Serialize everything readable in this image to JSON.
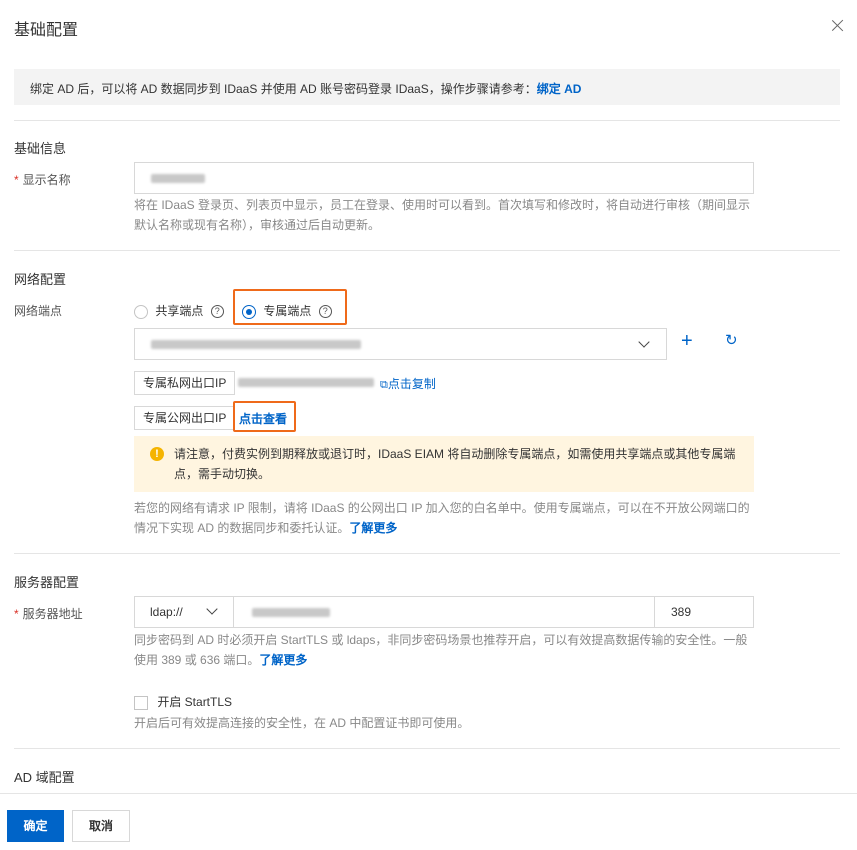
{
  "dialog": {
    "title": "基础配置"
  },
  "notice": {
    "text": "绑定 AD 后，可以将 AD 数据同步到 IDaaS 并使用 AD 账号密码登录 IDaaS，操作步骤请参考：",
    "link": "绑定 AD"
  },
  "basic_info": {
    "section_title": "基础信息",
    "display_name_label": "显示名称",
    "display_name_help": "将在 IDaaS 登录页、列表页中显示，员工在登录、使用时可以看到。首次填写和修改时，将自动进行审核（期间显示默认名称或现有名称），审核通过后自动更新。"
  },
  "network": {
    "section_title": "网络配置",
    "endpoint_label": "网络端点",
    "option_shared": "共享端点",
    "option_dedicated": "专属端点",
    "private_ip_button": "专属私网出口IP",
    "copy_link": "点击复制",
    "public_ip_button": "专属公网出口IP",
    "view_link": "点击查看",
    "warning": "请注意，付费实例到期释放或退订时，IDaaS EIAM 将自动删除专属端点，如需使用共享端点或其他专属端点，需手动切换。",
    "help": "若您的网络有请求 IP 限制，请将 IDaaS 的公网出口 IP 加入您的白名单中。使用专属端点，可以在不开放公网端口的情况下实现 AD 的数据同步和委托认证。",
    "help_link": "了解更多"
  },
  "server": {
    "section_title": "服务器配置",
    "address_label": "服务器地址",
    "protocol": "ldap://",
    "port": "389",
    "help": "同步密码到 AD 时必须开启 StartTLS 或 ldaps，非同步密码场景也推荐开启，可以有效提高数据传输的安全性。一般使用 389 或 636 端口。",
    "help_link": "了解更多",
    "starttls_label": "开启 StartTLS",
    "starttls_help": "开启后可有效提高连接的安全性，在 AD 中配置证书即可使用。"
  },
  "ad_domain": {
    "section_title": "AD 域配置"
  },
  "footer": {
    "confirm": "确定",
    "cancel": "取消"
  },
  "colors": {
    "primary": "#0064c8",
    "highlight": "#ef6a1a",
    "warning_bg": "#fff5e0"
  }
}
